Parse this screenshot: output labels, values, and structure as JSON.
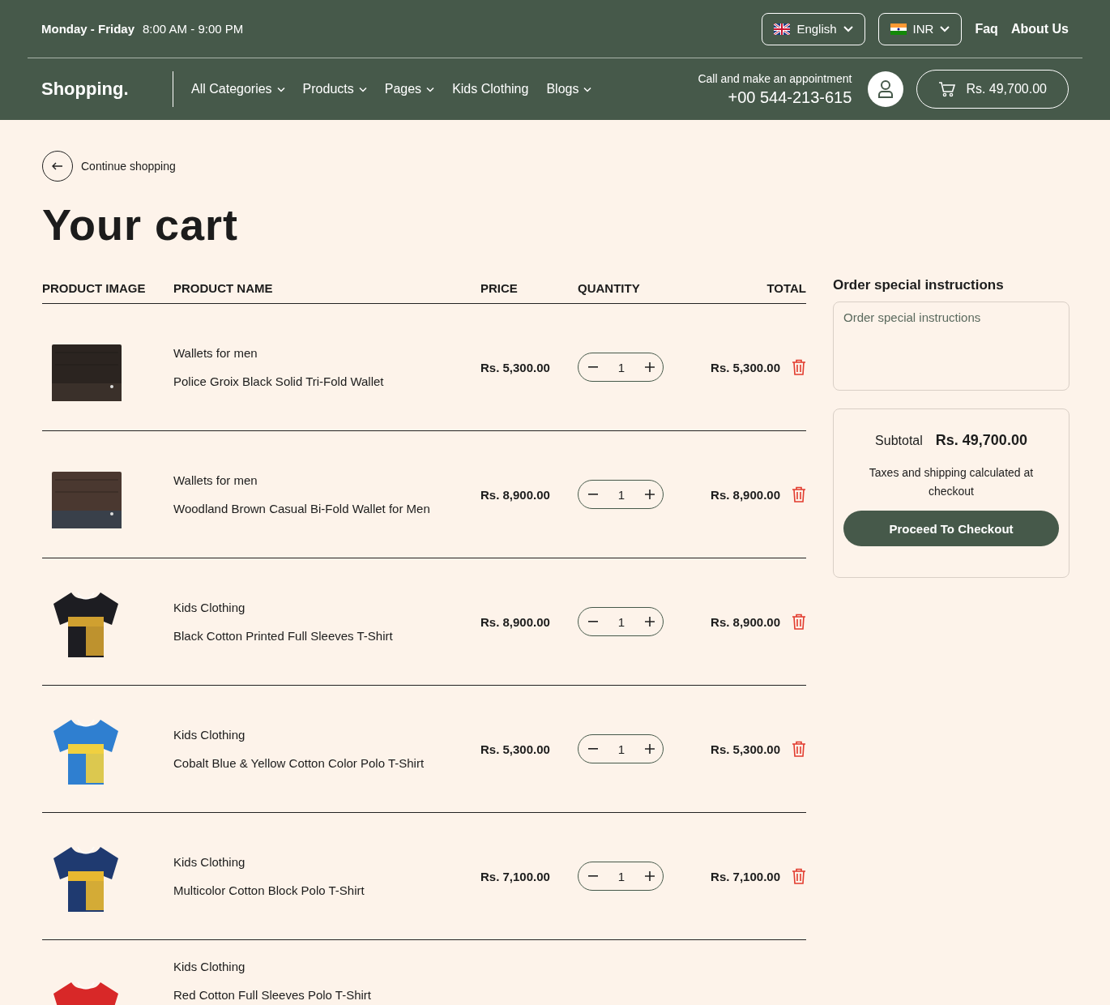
{
  "topbar": {
    "hours_days": "Monday - Friday",
    "hours_time": "8:00 AM - 9:00 PM",
    "language": "English",
    "currency": "INR",
    "links": [
      "Faq",
      "About Us"
    ]
  },
  "nav": {
    "logo": "Shopping.",
    "items": [
      {
        "label": "All Categories",
        "dropdown": true
      },
      {
        "label": "Products",
        "dropdown": true
      },
      {
        "label": "Pages",
        "dropdown": true
      },
      {
        "label": "Kids Clothing",
        "dropdown": false
      },
      {
        "label": "Blogs",
        "dropdown": true
      }
    ],
    "call_label": "Call and make an appointment",
    "phone": "+00 544-213-615",
    "cart_total": "Rs. 49,700.00"
  },
  "back_link": "Continue shopping",
  "title": "Your cart",
  "columns": [
    "PRODUCT IMAGE",
    "PRODUCT NAME",
    "PRICE",
    "QUANTITY",
    "TOTAL"
  ],
  "rows": [
    {
      "category": "Wallets for men",
      "name": "Police Groix Black Solid Tri-Fold Wallet",
      "price": "Rs. 5,300.00",
      "quantity": "1",
      "total": "Rs. 5,300.00"
    },
    {
      "category": "Wallets for men",
      "name": "Woodland Brown Casual Bi-Fold Wallet for Men",
      "price": "Rs. 8,900.00",
      "quantity": "1",
      "total": "Rs. 8,900.00"
    },
    {
      "category": "Kids Clothing",
      "name": "Black Cotton Printed Full Sleeves T-Shirt",
      "price": "Rs. 8,900.00",
      "quantity": "1",
      "total": "Rs. 8,900.00"
    },
    {
      "category": "Kids Clothing",
      "name": "Cobalt Blue & Yellow Cotton Color Polo T-Shirt",
      "price": "Rs. 5,300.00",
      "quantity": "1",
      "total": "Rs. 5,300.00"
    },
    {
      "category": "Kids Clothing",
      "name": "Multicolor Cotton Block Polo T-Shirt",
      "price": "Rs. 7,100.00",
      "quantity": "1",
      "total": "Rs. 7,100.00"
    },
    {
      "category": "Kids Clothing",
      "name": "Red Cotton Full Sleeves Polo T-Shirt"
    }
  ],
  "instructions": {
    "heading": "Order special instructions",
    "placeholder": "Order special instructions"
  },
  "summary": {
    "subtotal_label": "Subtotal",
    "subtotal": "Rs. 49,700.00",
    "note": "Taxes and shipping calculated at checkout",
    "button": "Proceed To Checkout"
  }
}
